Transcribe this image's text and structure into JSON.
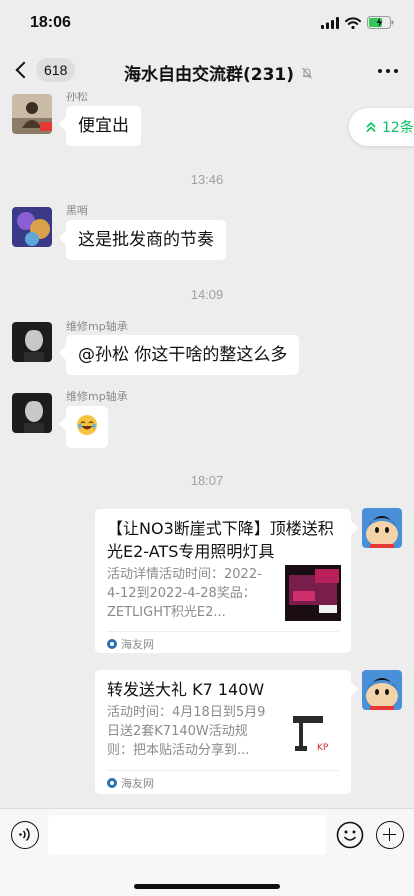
{
  "status_bar": {
    "time": "18:06"
  },
  "nav": {
    "unread_count": "618",
    "title": "海水自由交流群(231)"
  },
  "new_messages": {
    "label": "12条"
  },
  "messages": [
    {
      "sender": "孙松",
      "text": "便宜出"
    },
    {
      "sender": "黑哨",
      "text": "这是批发商的节奏"
    },
    {
      "sender": "维修mp轴承",
      "text": "@孙松 你这干啥的整这么多"
    },
    {
      "sender": "维修mp轴承",
      "text": "😂"
    }
  ],
  "timestamps": [
    "13:46",
    "14:09",
    "18:07"
  ],
  "cards": [
    {
      "title": "【让NO3断崖式下降】顶楼送积光E2-ATS专用照明灯具",
      "desc": "活动详情活动时间：2022-4-12到2022-4-28奖品：ZETLIGHT积光E2...",
      "source": "海友网"
    },
    {
      "title": "转发送大礼 K7 140W",
      "desc": "活动时间：4月18日到5月9日送2套K7140W活动规则：把本贴活动分享到...",
      "source": "海友网"
    }
  ],
  "colors": {
    "accent": "#07c160",
    "background": "#ededed",
    "bubble": "#ffffff"
  }
}
